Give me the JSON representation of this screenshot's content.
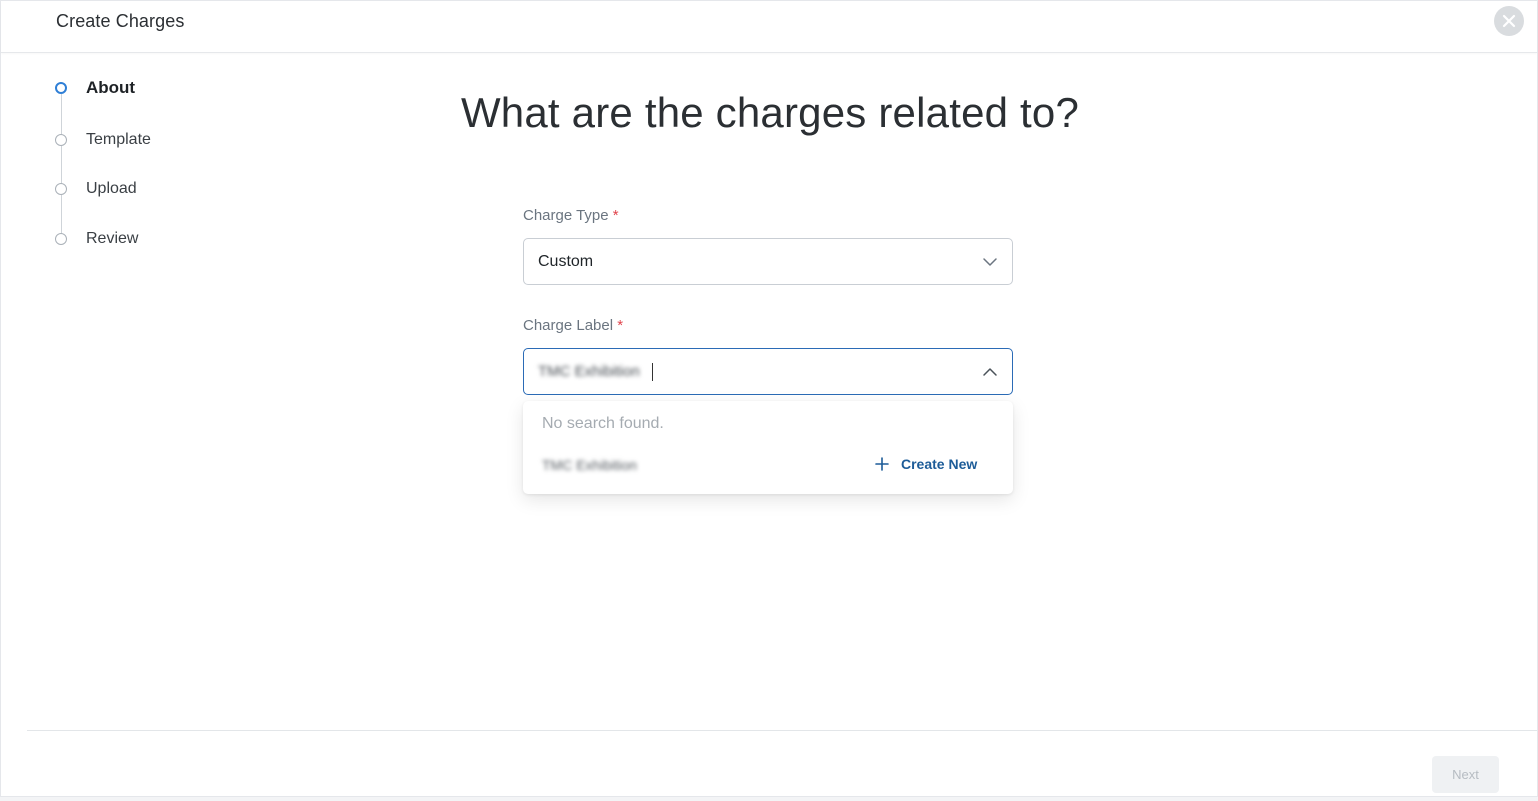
{
  "header": {
    "title": "Create Charges",
    "close_icon": "close-icon"
  },
  "stepper": {
    "steps": [
      {
        "label": "About",
        "active": true
      },
      {
        "label": "Template",
        "active": false
      },
      {
        "label": "Upload",
        "active": false
      },
      {
        "label": "Review",
        "active": false
      }
    ]
  },
  "main": {
    "title": "What are the charges related to?"
  },
  "charge_type": {
    "label": "Charge Type",
    "required_mark": "*",
    "value": "Custom",
    "icon": "chevron-down-icon"
  },
  "charge_label": {
    "label": "Charge Label",
    "required_mark": "*",
    "value": "TMC Exhibition",
    "icon": "chevron-up-icon"
  },
  "dropdown": {
    "empty_text": "No search found.",
    "option_text": "TMC Exhibition",
    "create_new_label": "Create New",
    "create_icon": "plus-icon"
  },
  "footer": {
    "next_label": "Next"
  },
  "colors": {
    "accent": "#2f7fd6",
    "link": "#1d5c98",
    "required": "#e0434b",
    "focus_border": "#2b6bb6"
  }
}
